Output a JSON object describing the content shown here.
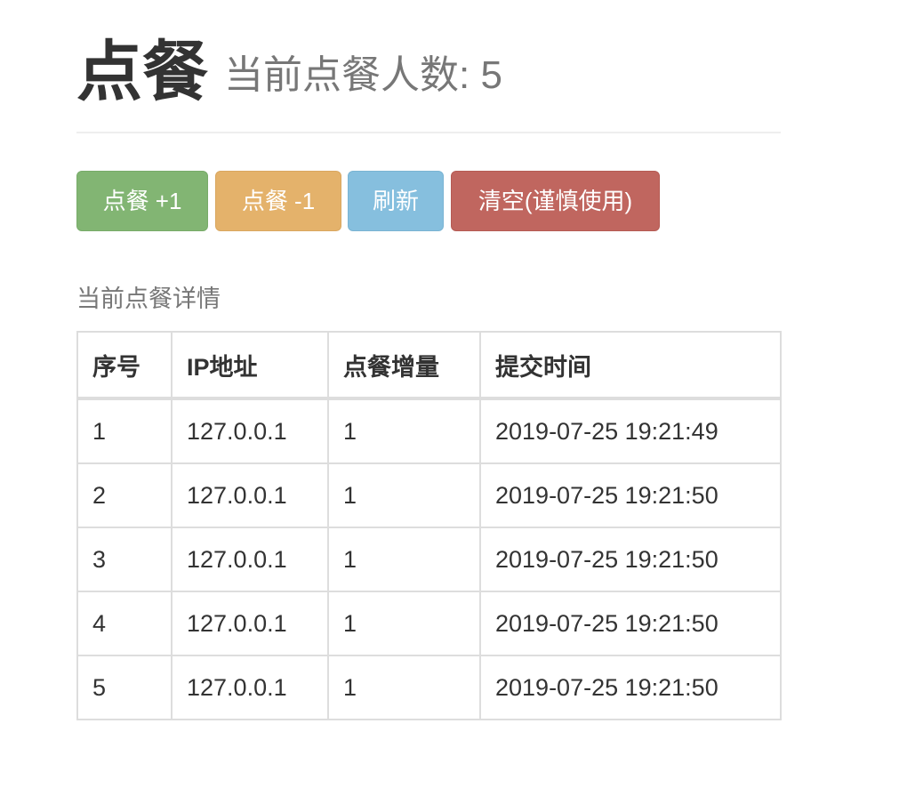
{
  "header": {
    "title": "点餐",
    "subtitle": "当前点餐人数: 5"
  },
  "toolbar": {
    "add_label": "点餐 +1",
    "remove_label": "点餐 -1",
    "refresh_label": "刷新",
    "clear_label": "清空(谨慎使用)"
  },
  "colors": {
    "success": "#82b573",
    "warning": "#e4b26b",
    "info": "#86bfde",
    "danger": "#c0665f"
  },
  "details": {
    "caption": "当前点餐详情",
    "columns": [
      "序号",
      "IP地址",
      "点餐增量",
      "提交时间"
    ],
    "rows": [
      [
        "1",
        "127.0.0.1",
        "1",
        "2019-07-25 19:21:49"
      ],
      [
        "2",
        "127.0.0.1",
        "1",
        "2019-07-25 19:21:50"
      ],
      [
        "3",
        "127.0.0.1",
        "1",
        "2019-07-25 19:21:50"
      ],
      [
        "4",
        "127.0.0.1",
        "1",
        "2019-07-25 19:21:50"
      ],
      [
        "5",
        "127.0.0.1",
        "1",
        "2019-07-25 19:21:50"
      ]
    ]
  }
}
